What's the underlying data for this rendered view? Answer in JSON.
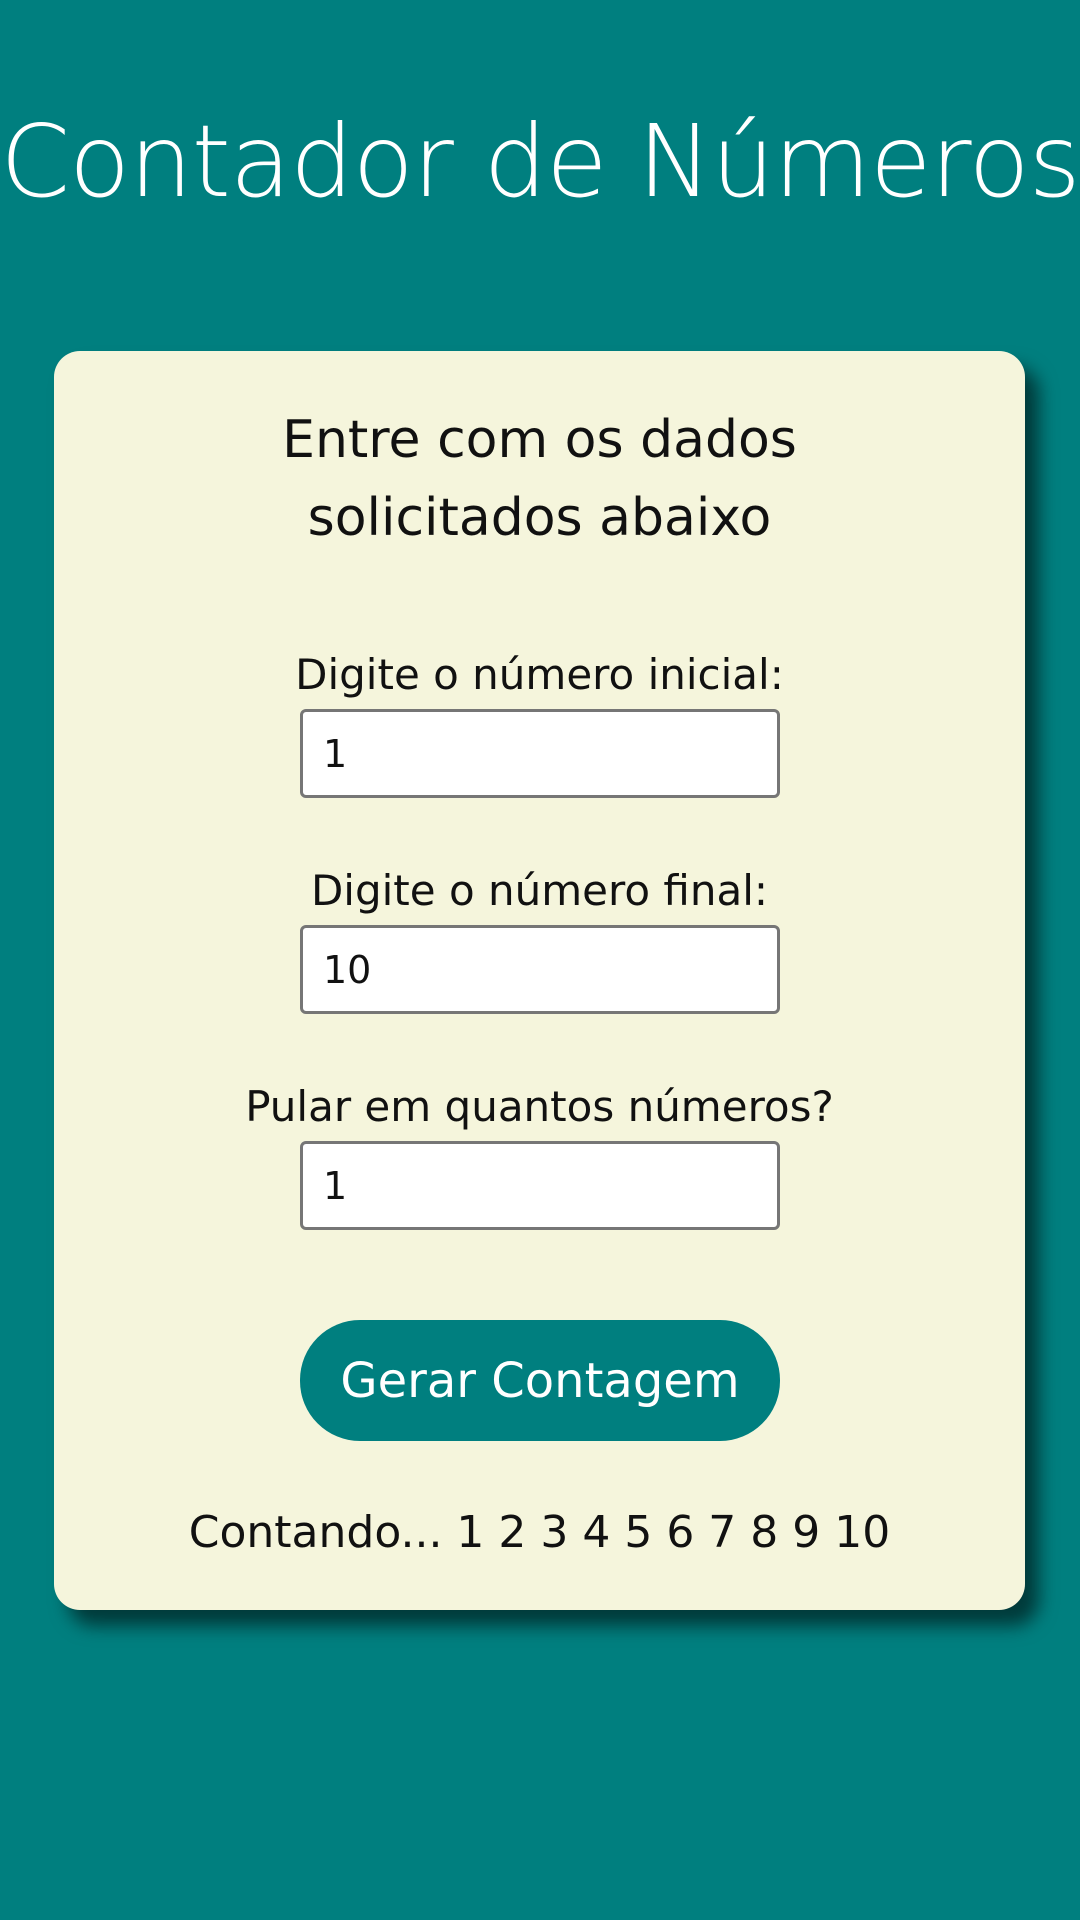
{
  "header": {
    "title": "Contador de Números"
  },
  "form": {
    "heading": "Entre com os dados solicitados abaixo",
    "fields": [
      {
        "label": "Digite o número inicial:",
        "value": "1"
      },
      {
        "label": "Digite o número final:",
        "value": "10"
      },
      {
        "label": "Pular em quantos números?",
        "value": "1"
      }
    ],
    "button_label": "Gerar Contagem",
    "result": "Contando... 1 2 3 4 5 6 7 8 9 10"
  },
  "colors": {
    "background": "#007f7f",
    "card": "#f5f5dc",
    "button": "#007f7f",
    "title_text": "#ffffff"
  }
}
